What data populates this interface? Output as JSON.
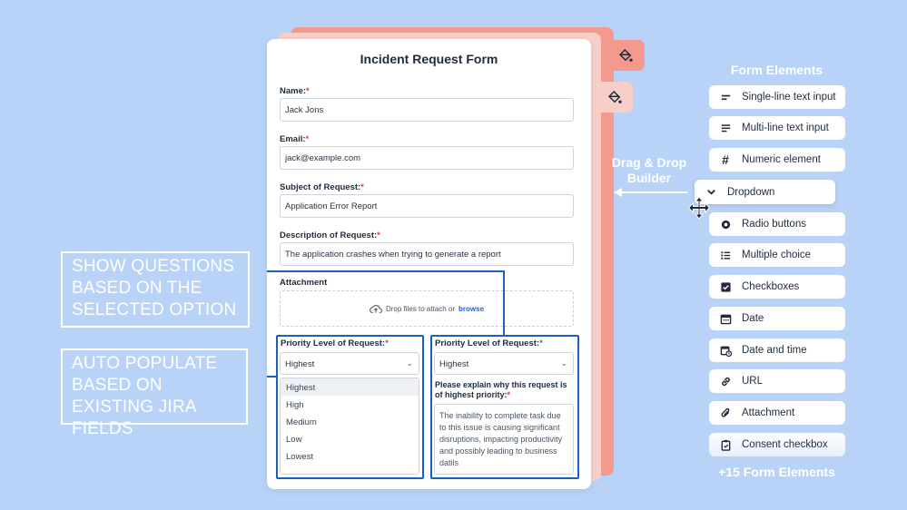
{
  "form": {
    "title": "Incident Request Form",
    "name_label": "Name:",
    "name_value": "Jack Jons",
    "email_label": "Email:",
    "email_value": "jack@example.com",
    "subject_label": "Subject of Request:",
    "subject_value": "Application Error Report",
    "description_label": "Description of Request:",
    "description_value": "The application crashes when trying to generate a report",
    "required_mark": "*",
    "attachment_label": "Attachment",
    "drop_text": "Drop files to attach or",
    "browse_text": "browse"
  },
  "priority_left": {
    "label": "Priority Level of Request:",
    "selected": "Highest",
    "options": [
      "Highest",
      "High",
      "Medium",
      "Low",
      "Lowest"
    ]
  },
  "priority_right": {
    "label": "Priority Level of Request:",
    "selected": "Highest",
    "explain_label": "Please explain why this request is of highest priority:",
    "explain_text": "The inability to complete task due to this issue is causing significant disruptions, impacting productivity and possibly leading to business datils"
  },
  "callouts": {
    "show_questions": "SHOW QUESTIONS BASED ON THE SELECTED OPTION",
    "auto_populate": "AUTO POPULATE BASED ON EXISTING JIRA FIELDS"
  },
  "builder": {
    "drag_drop_label": "Drag & Drop Builder"
  },
  "form_elements": {
    "title": "Form Elements",
    "items": [
      {
        "label": "Single-line text input",
        "icon": "short-text-icon"
      },
      {
        "label": "Multi-line text input",
        "icon": "long-text-icon"
      },
      {
        "label": "Numeric element",
        "icon": "hash-icon"
      },
      {
        "label": "Dropdown",
        "icon": "chevron-down-icon"
      },
      {
        "label": "Radio buttons",
        "icon": "radio-icon"
      },
      {
        "label": "Multiple choice",
        "icon": "list-icon"
      },
      {
        "label": "Checkboxes",
        "icon": "checkbox-icon"
      },
      {
        "label": "Date",
        "icon": "calendar-icon"
      },
      {
        "label": "Date and time",
        "icon": "calendar-clock-icon"
      },
      {
        "label": "URL",
        "icon": "link-icon"
      },
      {
        "label": "Attachment",
        "icon": "paperclip-icon"
      },
      {
        "label": "Consent checkbox",
        "icon": "clipboard-check-icon"
      }
    ],
    "more": "+15 Form Elements"
  },
  "colors": {
    "background": "#b8d3f7",
    "accent_blue": "#1b5fc4",
    "salmon": "#f3998d",
    "required_red": "#d6453b"
  }
}
